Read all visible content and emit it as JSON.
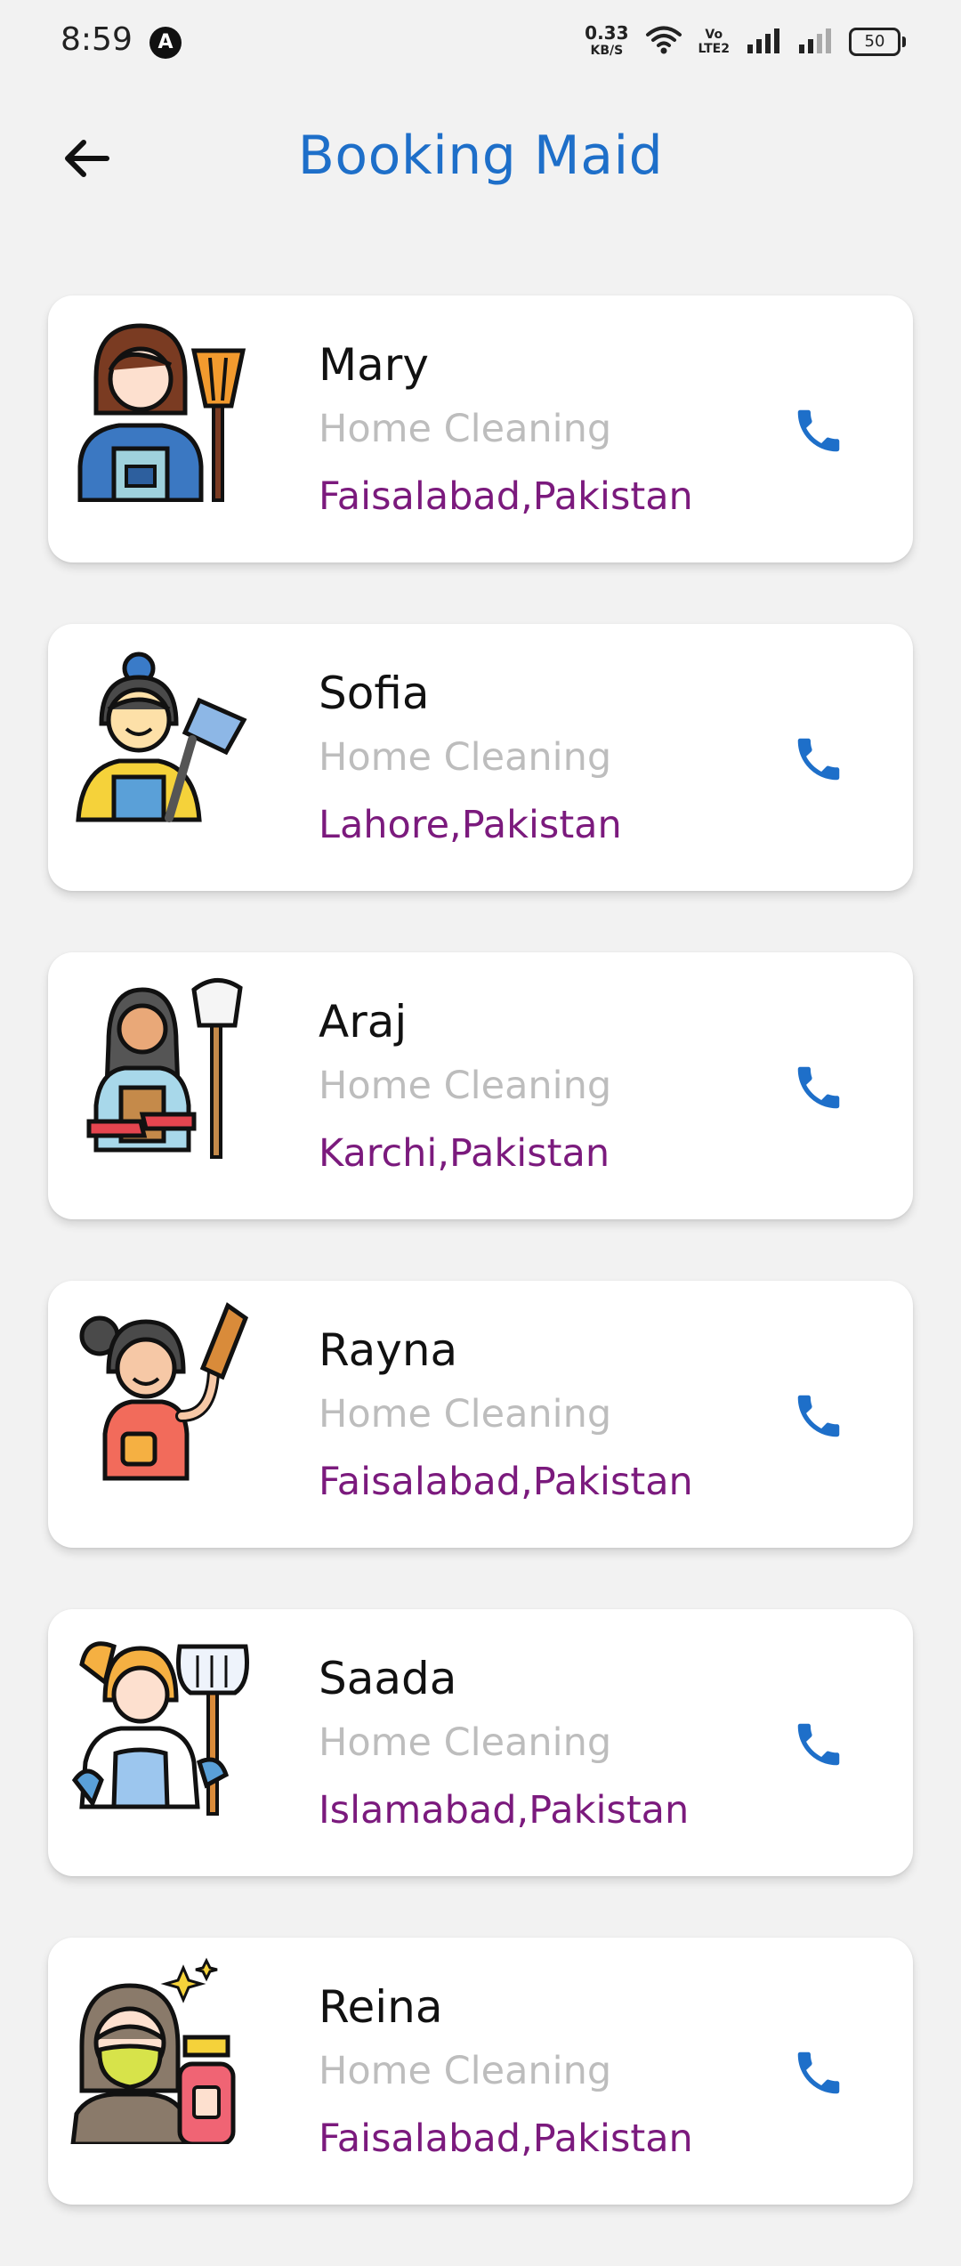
{
  "status_bar": {
    "time": "8:59",
    "badge": "A",
    "net_speed_value": "0.33",
    "net_speed_unit": "KB/S",
    "volte_top": "Vo",
    "volte_bottom": "LTE2",
    "battery": "50"
  },
  "header": {
    "title": "Booking Maid",
    "back_icon": "arrow-left-icon"
  },
  "colors": {
    "title": "#1e6fc9",
    "call_icon": "#1e6fc9",
    "service": "#bdbdbd",
    "location": "#7b1a7d",
    "background": "#f2f2f2"
  },
  "maids": [
    {
      "name": "Mary",
      "service": "Home Cleaning",
      "location": "Faisalabad,Pakistan",
      "avatar_icon": "maid-with-broom-icon",
      "call_icon": "phone-icon"
    },
    {
      "name": "Sofia",
      "service": "Home Cleaning",
      "location": "Lahore,Pakistan",
      "avatar_icon": "maid-with-brush-icon",
      "call_icon": "phone-icon"
    },
    {
      "name": "Araj",
      "service": "Home Cleaning",
      "location": "Karchi,Pakistan",
      "avatar_icon": "maid-with-duster-icon",
      "call_icon": "phone-icon"
    },
    {
      "name": "Rayna",
      "service": "Home Cleaning",
      "location": "Faisalabad,Pakistan",
      "avatar_icon": "maid-with-feather-duster-icon",
      "call_icon": "phone-icon"
    },
    {
      "name": "Saada",
      "service": "Home Cleaning",
      "location": "Islamabad,Pakistan",
      "avatar_icon": "maid-with-mop-icon",
      "call_icon": "phone-icon"
    },
    {
      "name": "Reina",
      "service": "Home Cleaning",
      "location": "Faisalabad,Pakistan",
      "avatar_icon": "maid-with-spray-bottle-icon",
      "call_icon": "phone-icon"
    }
  ]
}
